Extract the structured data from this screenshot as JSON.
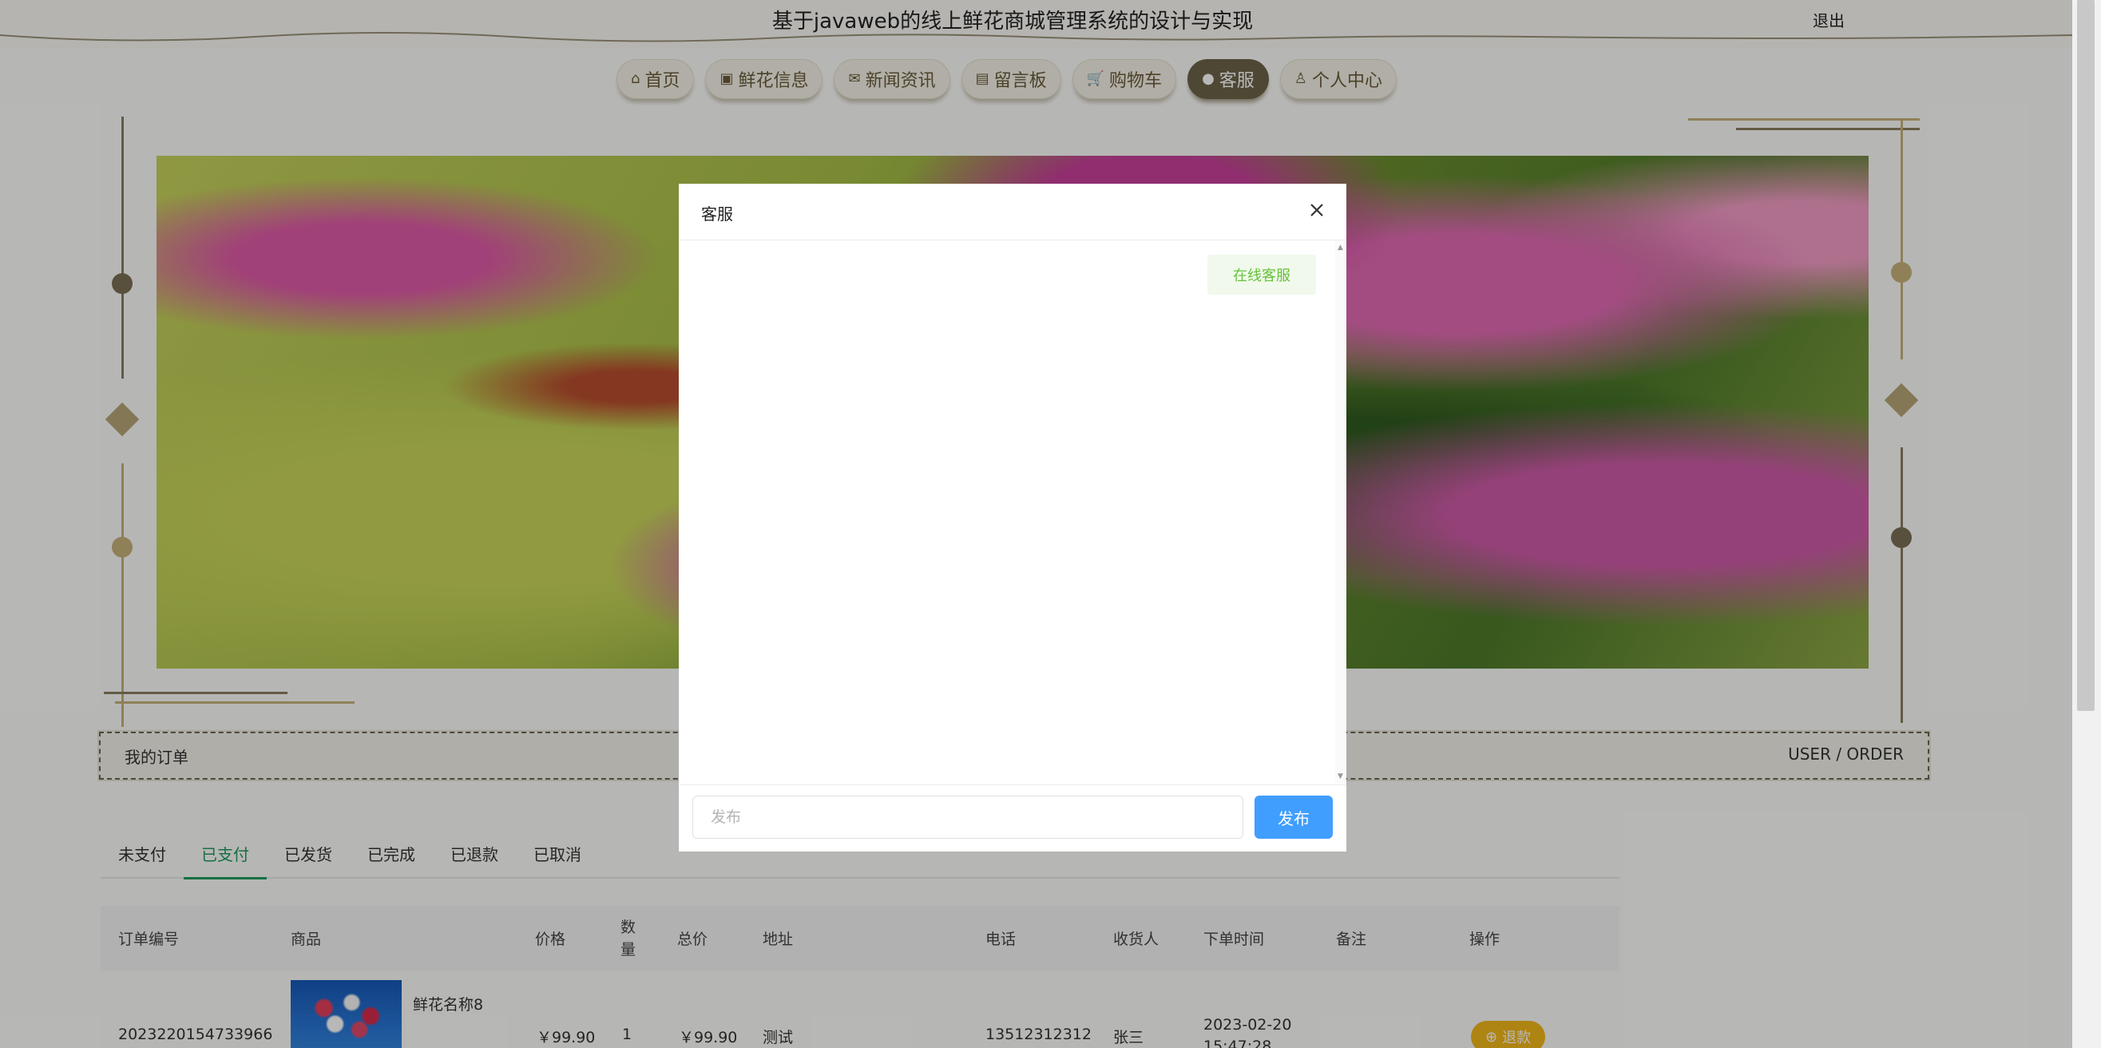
{
  "header": {
    "title": "基于javaweb的线上鲜花商城管理系统的设计与实现",
    "logout": "退出"
  },
  "nav": [
    {
      "label": "首页",
      "icon": "home-icon",
      "glyph": "⌂"
    },
    {
      "label": "鲜花信息",
      "icon": "gift-icon",
      "glyph": "▣"
    },
    {
      "label": "新闻资讯",
      "icon": "mail-icon",
      "glyph": "✉"
    },
    {
      "label": "留言板",
      "icon": "notes-icon",
      "glyph": "▤"
    },
    {
      "label": "购物车",
      "icon": "cart-icon",
      "glyph": "🛒"
    },
    {
      "label": "客服",
      "icon": "chat-icon",
      "glyph": "●",
      "active": true
    },
    {
      "label": "个人中心",
      "icon": "user-icon",
      "glyph": "♙"
    }
  ],
  "order_bar": {
    "left": "我的订单",
    "right": "USER / ORDER"
  },
  "tabs": [
    "未支付",
    "已支付",
    "已发货",
    "已完成",
    "已退款",
    "已取消"
  ],
  "active_tab": "已支付",
  "table": {
    "headers": [
      "订单编号",
      "商品",
      "价格",
      "数量",
      "总价",
      "地址",
      "电话",
      "收货人",
      "下单时间",
      "备注",
      "操作"
    ],
    "rows": [
      {
        "order_no": "2023220154733966",
        "product": "鲜花名称8",
        "price": "￥99.90",
        "qty": "1",
        "total": "￥99.90",
        "address": "测试",
        "phone": "13512312312",
        "receiver": "张三",
        "time_date": "2023-02-20",
        "time_clock": "15:47:28",
        "note": "",
        "action": "退款"
      }
    ]
  },
  "modal": {
    "title": "客服",
    "messages": [
      "在线客服"
    ],
    "input_placeholder": "发布",
    "send_label": "发布"
  },
  "colors": {
    "accent_green": "#1f9a5a",
    "send_blue": "#409eff",
    "refund_yellow": "#f2b71a",
    "nav_active": "#6c6349"
  }
}
